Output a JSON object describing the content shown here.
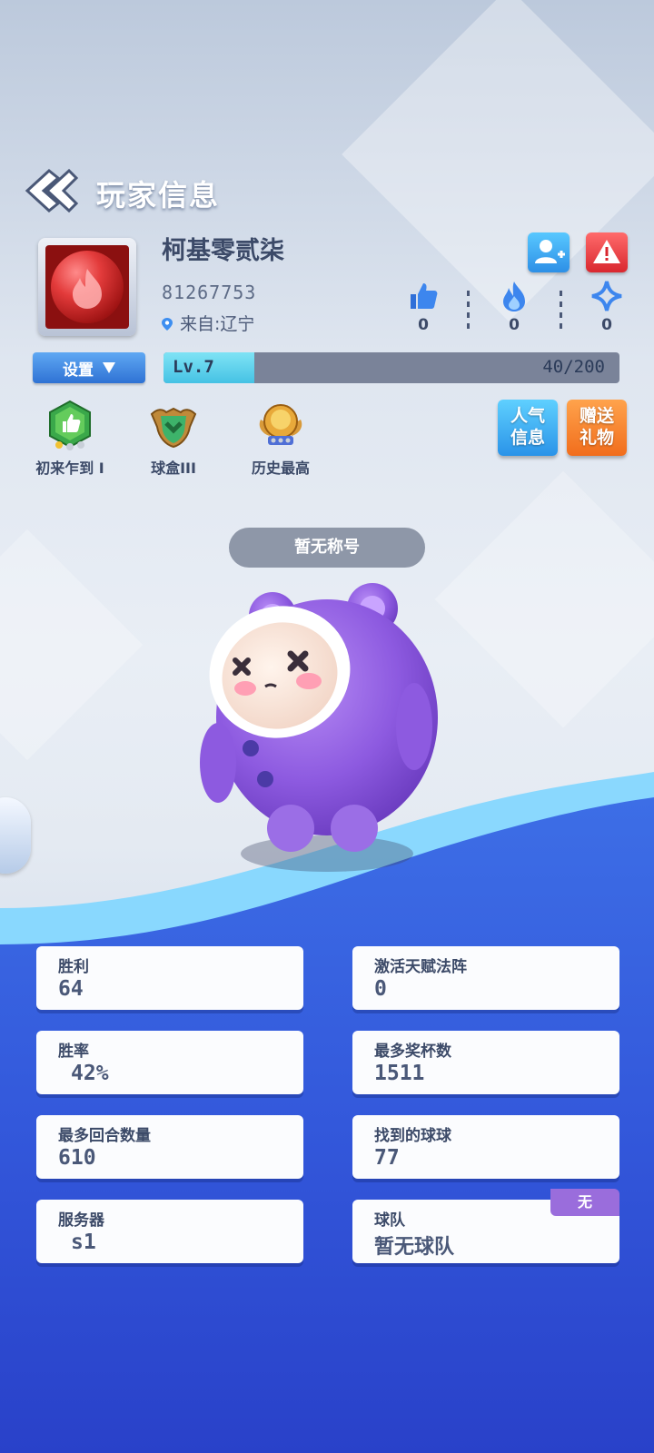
{
  "header": {
    "title": "玩家信息"
  },
  "player": {
    "name": "柯基零贰柒",
    "id": "81267753",
    "location": "来自:辽宁",
    "level_label": "Lv.7",
    "xp_text": "40/200",
    "xp_progress": 0.2
  },
  "stats_top": [
    {
      "icon": "thumbs-up-icon",
      "value": "0"
    },
    {
      "icon": "flame-icon",
      "value": "0"
    },
    {
      "icon": "star-sparkle-icon",
      "value": "0"
    }
  ],
  "settings": {
    "label": "设置"
  },
  "badges": [
    {
      "icon": "thumbs-up-badge-icon",
      "label": "初来乍到 I"
    },
    {
      "icon": "shield-chevron-badge-icon",
      "label": "球盒III"
    },
    {
      "icon": "gold-medal-badge-icon",
      "label": "历史最高"
    }
  ],
  "buttons": {
    "popularity": "人气\n信息",
    "gift": "赠送\n礼物"
  },
  "character": {
    "title": "暂无称号"
  },
  "stats": {
    "wins": {
      "label": "胜利",
      "value": "64"
    },
    "talent": {
      "label": "激活天赋法阵",
      "value": "0"
    },
    "win_rate": {
      "label": "胜率",
      "value": "42%"
    },
    "trophies": {
      "label": "最多奖杯数",
      "value": "1511"
    },
    "rounds": {
      "label": "最多回合数量",
      "value": "610"
    },
    "balls": {
      "label": "找到的球球",
      "value": "77"
    },
    "server": {
      "label": "服务器",
      "value": "s1"
    },
    "team": {
      "label": "球队",
      "value": "暂无球队",
      "tag": "无"
    }
  },
  "colors": {
    "accent_blue": "#2f72d4",
    "bottom_blue": "#2c4fd6",
    "gift_orange": "#f16d1c",
    "team_purple": "#9a6ddc"
  }
}
